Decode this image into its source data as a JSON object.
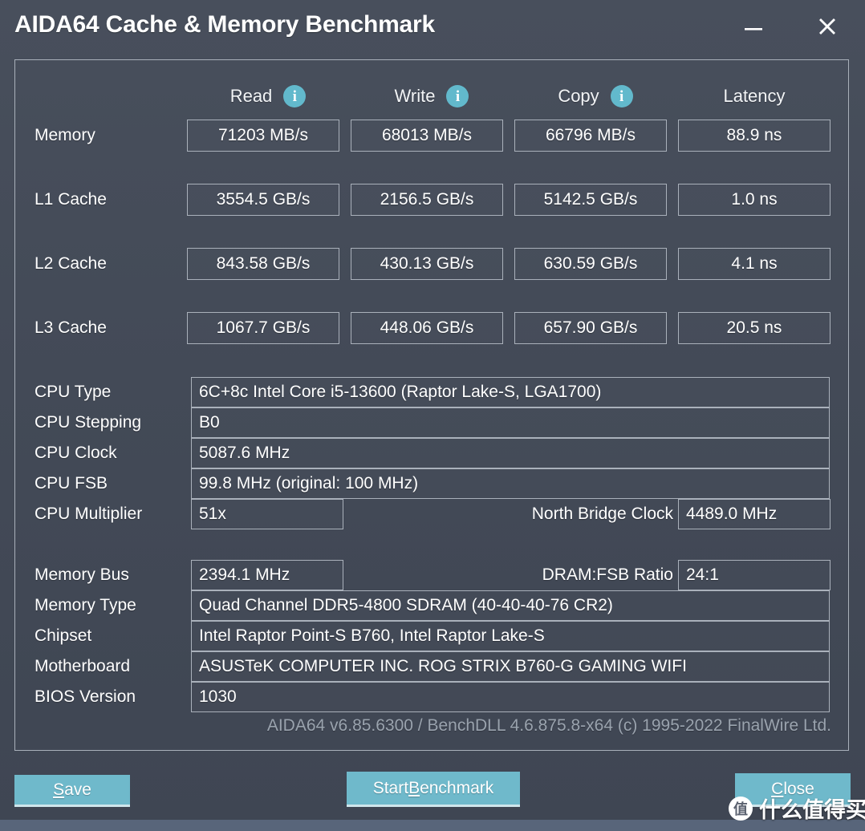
{
  "window": {
    "title": "AIDA64 Cache & Memory Benchmark",
    "minimize_label": "minimize",
    "close_label": "close"
  },
  "benchmark": {
    "columns": [
      {
        "label": "Read",
        "has_info": true
      },
      {
        "label": "Write",
        "has_info": true
      },
      {
        "label": "Copy",
        "has_info": true
      },
      {
        "label": "Latency",
        "has_info": false
      }
    ],
    "rows": [
      {
        "label": "Memory",
        "read": "71203 MB/s",
        "write": "68013 MB/s",
        "copy": "66796 MB/s",
        "latency": "88.9 ns"
      },
      {
        "label": "L1 Cache",
        "read": "3554.5 GB/s",
        "write": "2156.5 GB/s",
        "copy": "5142.5 GB/s",
        "latency": "1.0 ns"
      },
      {
        "label": "L2 Cache",
        "read": "843.58 GB/s",
        "write": "430.13 GB/s",
        "copy": "630.59 GB/s",
        "latency": "4.1 ns"
      },
      {
        "label": "L3 Cache",
        "read": "1067.7 GB/s",
        "write": "448.06 GB/s",
        "copy": "657.90 GB/s",
        "latency": "20.5 ns"
      }
    ]
  },
  "cpu_info": {
    "type_label": "CPU Type",
    "type_value": "6C+8c Intel Core i5-13600  (Raptor Lake-S, LGA1700)",
    "stepping_label": "CPU Stepping",
    "stepping_value": "B0",
    "clock_label": "CPU Clock",
    "clock_value": "5087.6 MHz",
    "fsb_label": "CPU FSB",
    "fsb_value": "99.8 MHz  (original: 100 MHz)",
    "multiplier_label": "CPU Multiplier",
    "multiplier_value": "51x",
    "north_bridge_label": "North Bridge Clock",
    "north_bridge_value": "4489.0 MHz"
  },
  "memory_info": {
    "bus_label": "Memory Bus",
    "bus_value": "2394.1 MHz",
    "ratio_label": "DRAM:FSB Ratio",
    "ratio_value": "24:1",
    "type_label": "Memory Type",
    "type_value": "Quad Channel DDR5-4800 SDRAM  (40-40-40-76 CR2)",
    "chipset_label": "Chipset",
    "chipset_value": "Intel Raptor Point-S B760, Intel Raptor Lake-S",
    "motherboard_label": "Motherboard",
    "motherboard_value": "ASUSTeK COMPUTER INC. ROG STRIX B760-G GAMING WIFI",
    "bios_label": "BIOS Version",
    "bios_value": "1030"
  },
  "footer": {
    "version_text": "AIDA64 v6.85.6300 / BenchDLL 4.6.875.8-x64  (c) 1995-2022 FinalWire Ltd."
  },
  "buttons": {
    "save": {
      "accel": "S",
      "rest": "ave"
    },
    "start": {
      "pre": "Start ",
      "accel": "B",
      "rest": "enchmark"
    },
    "close": {
      "accel": "C",
      "rest": "lose"
    }
  },
  "watermark": {
    "badge": "值",
    "text": "什么值得买"
  },
  "colors": {
    "window_bg": "#454c59",
    "accent": "#6fb9cb",
    "info_icon": "#62b9cc",
    "border": "#aab1bb",
    "footer_text": "#9aa3ae"
  }
}
